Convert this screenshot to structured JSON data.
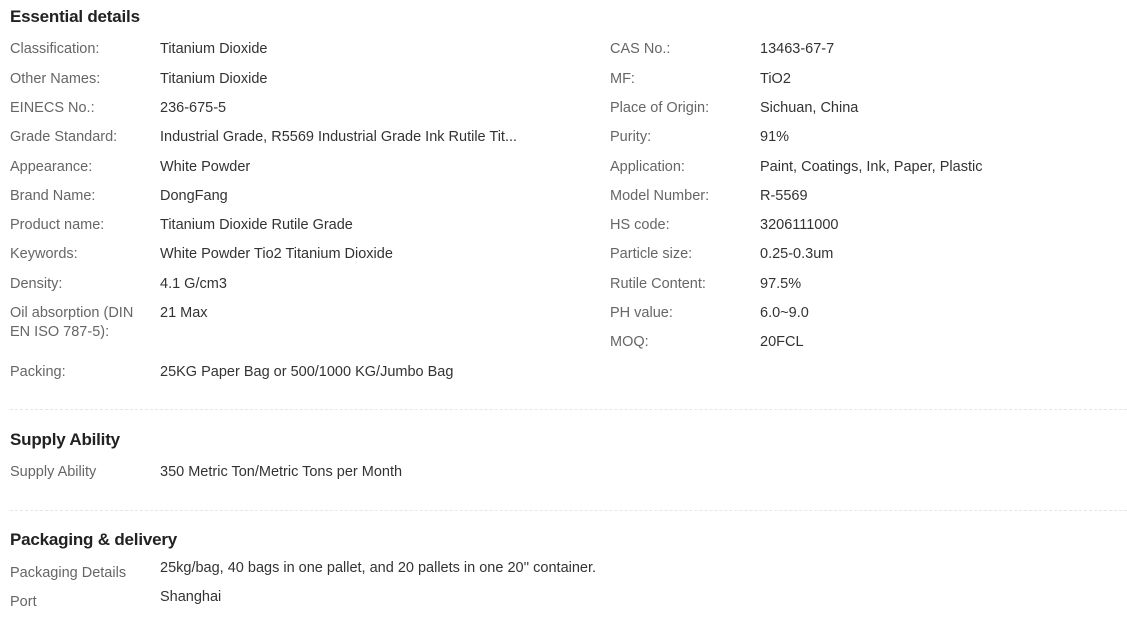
{
  "essential": {
    "title": "Essential details",
    "rows": [
      {
        "label": "Classification:",
        "value": "Titanium Dioxide"
      },
      {
        "label": "Other Names:",
        "value": "Titanium Dioxide"
      },
      {
        "label": "EINECS No.:",
        "value": "236-675-5"
      },
      {
        "label": "Grade Standard:",
        "value": "Industrial Grade, R5569 Industrial Grade Ink Rutile Tit..."
      },
      {
        "label": "Appearance:",
        "value": "White Powder"
      },
      {
        "label": "Brand Name:",
        "value": "DongFang"
      },
      {
        "label": "Product name:",
        "value": "Titanium Dioxide Rutile Grade"
      },
      {
        "label": "Keywords:",
        "value": "White Powder Tio2 Titanium Dioxide"
      },
      {
        "label": "Density:",
        "value": "4.1 G/cm3"
      },
      {
        "label": "Oil absorption (DIN EN ISO 787-5):",
        "value": "21 Max"
      },
      {
        "label": "Packing:",
        "value": "25KG Paper Bag or 500/1000 KG/Jumbo Bag"
      }
    ],
    "right_rows": [
      {
        "label": "CAS No.:",
        "value": "13463-67-7"
      },
      {
        "label": "MF:",
        "value": "TiO2"
      },
      {
        "label": "Place of Origin:",
        "value": "Sichuan, China"
      },
      {
        "label": "Purity:",
        "value": "91%"
      },
      {
        "label": "Application:",
        "value": "Paint, Coatings, Ink, Paper, Plastic"
      },
      {
        "label": "Model Number:",
        "value": "R-5569"
      },
      {
        "label": "HS code:",
        "value": "3206111000"
      },
      {
        "label": "Particle size:",
        "value": "0.25-0.3um"
      },
      {
        "label": "Rutile Content:",
        "value": "97.5%"
      },
      {
        "label": "PH value:",
        "value": "6.0~9.0"
      },
      {
        "label": "MOQ:",
        "value": "20FCL"
      }
    ]
  },
  "supply": {
    "title": "Supply Ability",
    "label": "Supply Ability",
    "value": "350 Metric Ton/Metric Tons per Month"
  },
  "packaging": {
    "title": "Packaging & delivery",
    "details_label": "Packaging Details",
    "details_value": "25kg/bag, 40 bags in one pallet, and 20 pallets in one 20'' container.",
    "port_label": "Port",
    "port_value": "Shanghai"
  }
}
